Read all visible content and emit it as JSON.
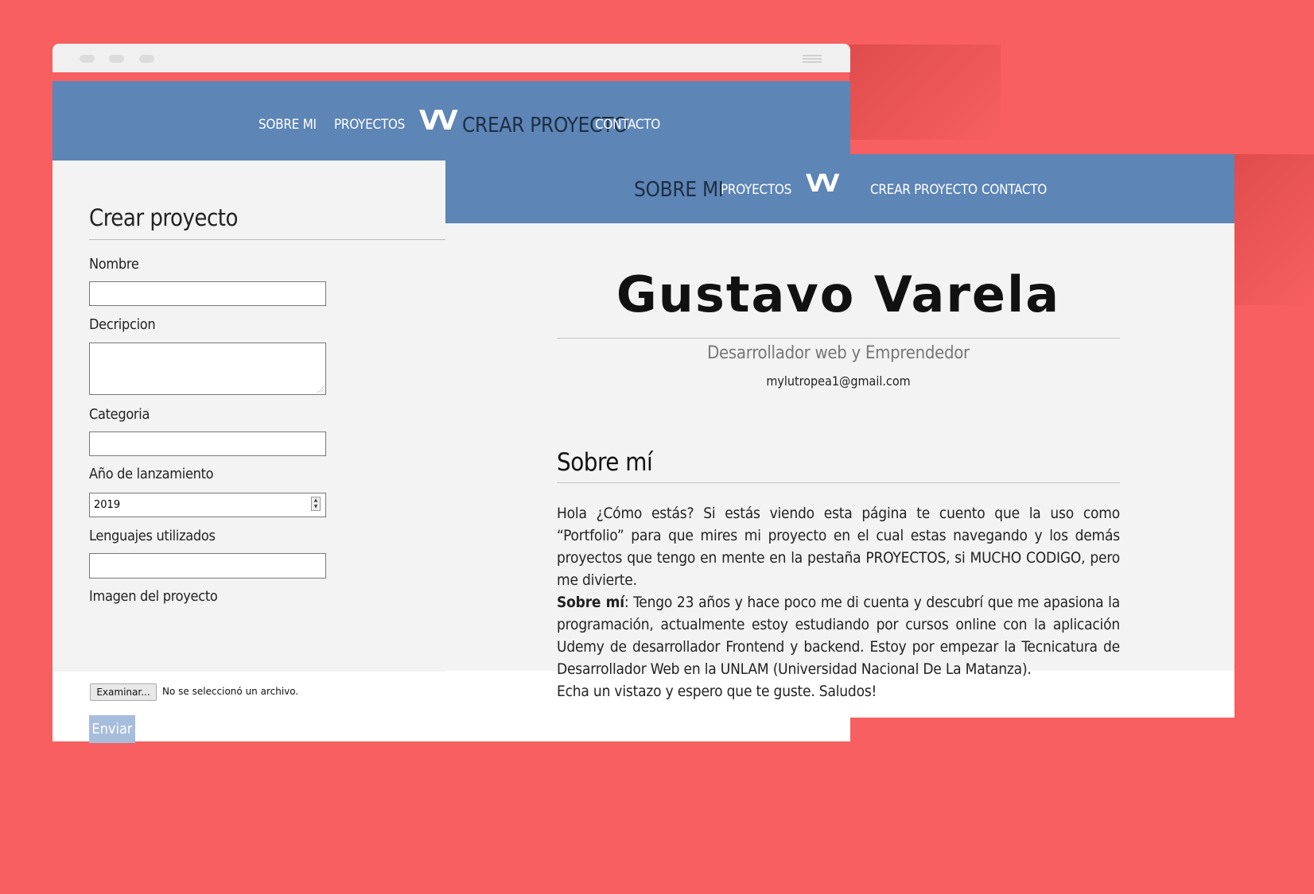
{
  "win1": {
    "nav": {
      "sobre_mi": "SOBRE MI",
      "proyectos": "PROYECTOS",
      "logo": "VV",
      "crear_proyecto": "CREAR PROYECTO",
      "contacto": "CONTACTO"
    },
    "form": {
      "title": "Crear proyecto",
      "nombre_label": "Nombre",
      "nombre_value": "",
      "descripcion_label": "Decripcion",
      "descripcion_value": "",
      "categoria_label": "Categoria",
      "categoria_value": "",
      "anio_label": "Año de lanzamiento",
      "anio_value": "2019",
      "lenguajes_label": "Lenguajes utilizados",
      "lenguajes_value": "",
      "imagen_label": "Imagen del proyecto",
      "file_button": "Examinar...",
      "file_status": "No se seleccionó un archivo.",
      "submit": "Enviar"
    }
  },
  "win2": {
    "nav": {
      "sobre_mi": "SOBRE MI",
      "proyectos": "PROYECTOS",
      "logo": "VV",
      "crear_proyecto": "CREAR PROYECTO",
      "contacto": "CONTACTO"
    },
    "profile": {
      "name": "Gustavo Varela",
      "subtitle": "Desarrollador web y Emprendedor",
      "email": "mylutropea1@gmail.com"
    },
    "about": {
      "heading": "Sobre mí",
      "p1": "Hola ¿Cómo estás? Si estás viendo esta página te cuento que la uso como “Portfolio” para que mires mi proyecto en el cual estas navegando y los demás proyectos que tengo en mente en la pestaña PROYECTOS, si MUCHO CODIGO, pero me diviertе.",
      "p2_bold": "Sobre mí",
      "p2": ": Tengo 23 años y hace poco me di cuenta y descubrí que me apasiona la programación, actualmente estoy estudiando por cursos online con la aplicación Udemy de desarrollador Frontend y backend. Estoy por empezar la Tecnicatura de Desarrollador Web en la UNLAM (Universidad Nacional De La Matanza).",
      "p3": "Echa un vistazo y espero que te guste. Saludos!"
    }
  },
  "colors": {
    "background": "#f75f60",
    "nav": "#5d85b6",
    "page": "#f3f3f3",
    "submit": "#a6bddc"
  }
}
